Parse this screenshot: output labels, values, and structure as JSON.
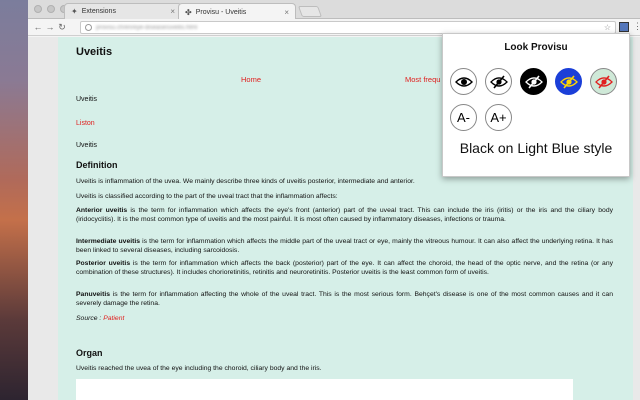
{
  "browser": {
    "tabs": [
      {
        "label": "Extensions",
        "icon": "puzzle-icon"
      },
      {
        "label": "Provisu - Uveitis",
        "icon": "provisu-icon"
      }
    ],
    "url": "provisu.ch/en/eye-disease/uveitis.html"
  },
  "page": {
    "title": "Uveitis",
    "nav": {
      "home": "Home",
      "most_frequent": "Most frequ"
    },
    "lines": [
      "Uveitis",
      "Liston",
      "Uveitis"
    ],
    "definition_heading": "Definition",
    "p1": "Uveitis is inflammation of the uvea. We mainly describe three kinds of uveitis posterior, intermediate and anterior.",
    "p2": "Uveitis is classified according to the part of the uveal tract that the inflammation affects:",
    "p3_term": "Anterior uveitis",
    "p3_text": " is the term for inflammation which affects the eye's front (anterior) part of the uveal tract. This can include the iris (iritis) or the iris and the ciliary body (iridocyclitis). It is the most common type of uveitis and the most painful. It is most often caused by inflammatory diseases, infections or trauma.",
    "p4_term": "Intermediate uveitis",
    "p4_text": " is the term for inflammation which affects the middle part of the uveal tract or eye, mainly the vitreous humour. It can also affect the underlying retina. It has been linked to several diseases, including sarcoidosis.",
    "p5_term": "Posterior uveitis",
    "p5_text": " is the term for inflammation which affects the back (posterior) part of the eye. It can affect the choroid, the head of the optic nerve, and the retina (or any combination of these structures). It includes chorioretinitis, retinitis and neuroretinitis. Posterior uveitis is the least common form of uveitis.",
    "p6_term": "Panuveitis",
    "p6_text": " is the term for inflammation affecting the whole of the uveal tract. This is the most serious form. Behçet's disease is one of the most common causes and it can severely damage the retina.",
    "source_label": "Source : ",
    "source_link": "Patient",
    "organ_heading": "Organ",
    "organ_text": "Uveitis reached the uvea of the eye including the choroid, ciliary body and the iris."
  },
  "popup": {
    "title": "Look Provisu",
    "buttons": [
      {
        "icon": "eye-icon"
      },
      {
        "icon": "eye-slash-icon"
      },
      {
        "icon": "eye-slash-white-on-black-icon"
      },
      {
        "icon": "eye-slash-yellow-on-blue-icon"
      },
      {
        "icon": "eye-slash-red-on-green-icon"
      }
    ],
    "decrease_label": "A-",
    "increase_label": "A+",
    "status": "Black on Light Blue style"
  },
  "colors": {
    "content_bg": "#d6efe8",
    "link_red": "#e0201f",
    "accent_blue": "#1b3fd8"
  }
}
